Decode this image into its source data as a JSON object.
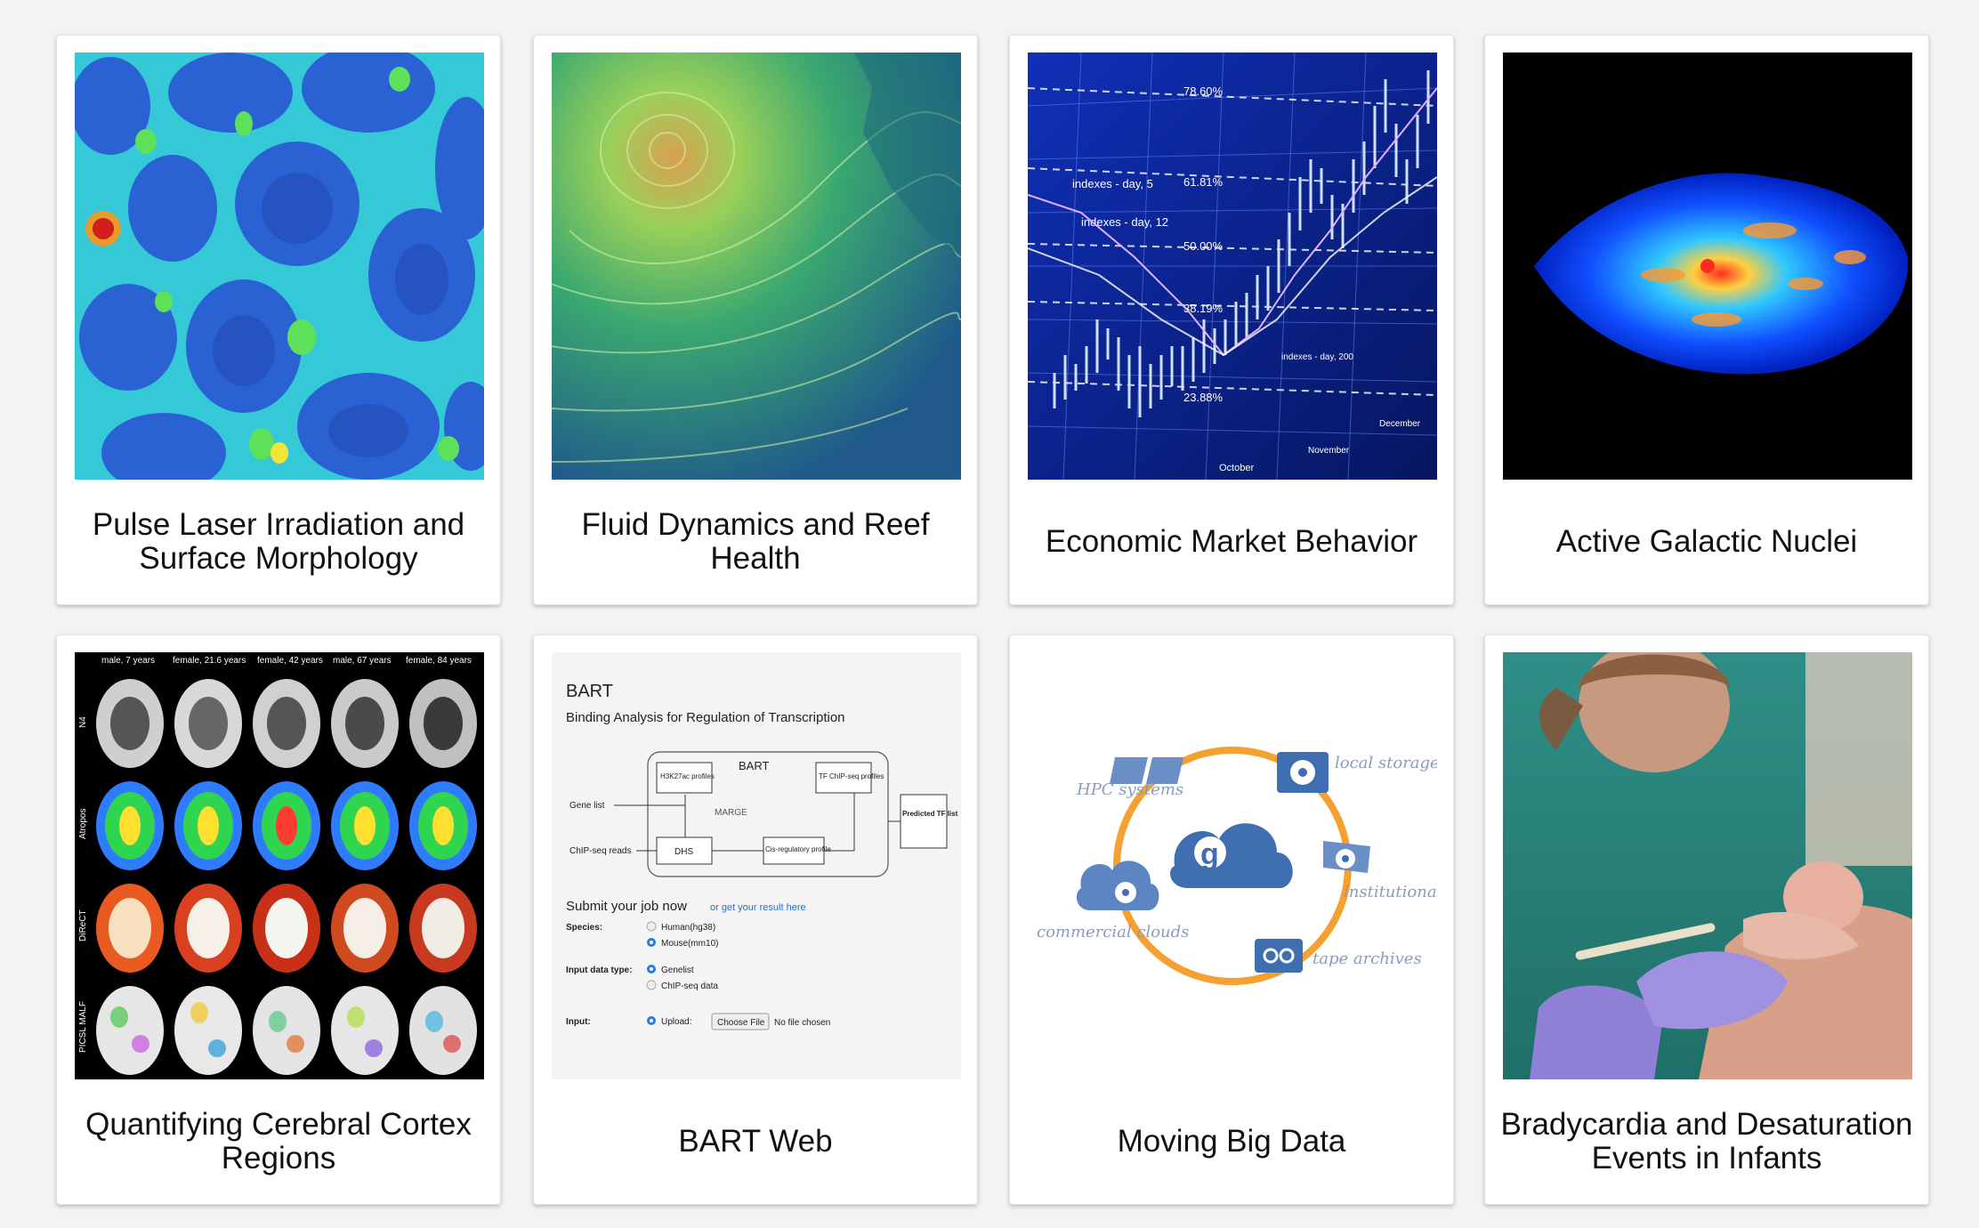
{
  "cards": [
    {
      "title": "Pulse Laser Irradiation and Surface Morphology",
      "image": "surface-morphology-image"
    },
    {
      "title": "Fluid Dynamics and Reef Health",
      "image": "wind-flow-image"
    },
    {
      "title": "Economic Market Behavior",
      "image": "stock-chart-image"
    },
    {
      "title": "Active Galactic Nuclei",
      "image": "galaxy-simulation-image"
    },
    {
      "title": "Quantifying Cerebral Cortex Regions",
      "image": "brain-mri-image"
    },
    {
      "title": "BART Web",
      "image": "bart-screenshot-image"
    },
    {
      "title": "Moving Big Data",
      "image": "globus-diagram-image"
    },
    {
      "title": "Bradycardia and Desaturation Events in Infants",
      "image": "infant-care-photo"
    }
  ],
  "stock_labels": [
    "78.60%",
    "61.81%",
    "50.00%",
    "38.19%",
    "23.88%",
    "indexes - day, 5",
    "indexes - day, 12",
    "indexes - day, 200",
    "October",
    "November",
    "December"
  ],
  "brain_labels": {
    "columns": [
      "male, 7 years",
      "female, 21.6 years",
      "female, 42 years",
      "male, 67 years",
      "female, 84 years"
    ],
    "rows": [
      "N4",
      "Atropos",
      "DiReCT",
      "PICSL MALF"
    ]
  },
  "bart": {
    "title": "BART",
    "subtitle": "Binding Analysis for Regulation of Transcription",
    "diagram": {
      "box_label": "BART",
      "h3k27ac": "H3K27ac profiles",
      "tfchip": "TF ChIP-seq profiles",
      "marge": "MARGE",
      "gene_list": "Gene list",
      "chip_reads": "ChIP-seq reads",
      "dhs": "DHS",
      "cis": "Cis-regulatory profile",
      "predicted": "Predicted TF list"
    },
    "submit": "Submit your job now",
    "result_link": "or get your result here",
    "species_label": "Species:",
    "species_options": [
      "Human(hg38)",
      "Mouse(mm10)"
    ],
    "input_data_label": "Input data type:",
    "input_data_options": [
      "Genelist",
      "ChIP-seq data"
    ],
    "input_label": "Input:",
    "upload": "Upload:",
    "choose_file": "Choose File",
    "no_file": "No file chosen"
  },
  "globus": {
    "hpc": "HPC systems",
    "local": "local storage",
    "institutional": "institutional storage",
    "tape": "tape archives",
    "commercial": "commercial clouds"
  },
  "colors": {
    "background": "#f3f3f3",
    "card": "#ffffff",
    "globus_orange": "#f5a030",
    "globus_blue": "#3f6fb0",
    "bart_link": "#2a6fd6"
  }
}
